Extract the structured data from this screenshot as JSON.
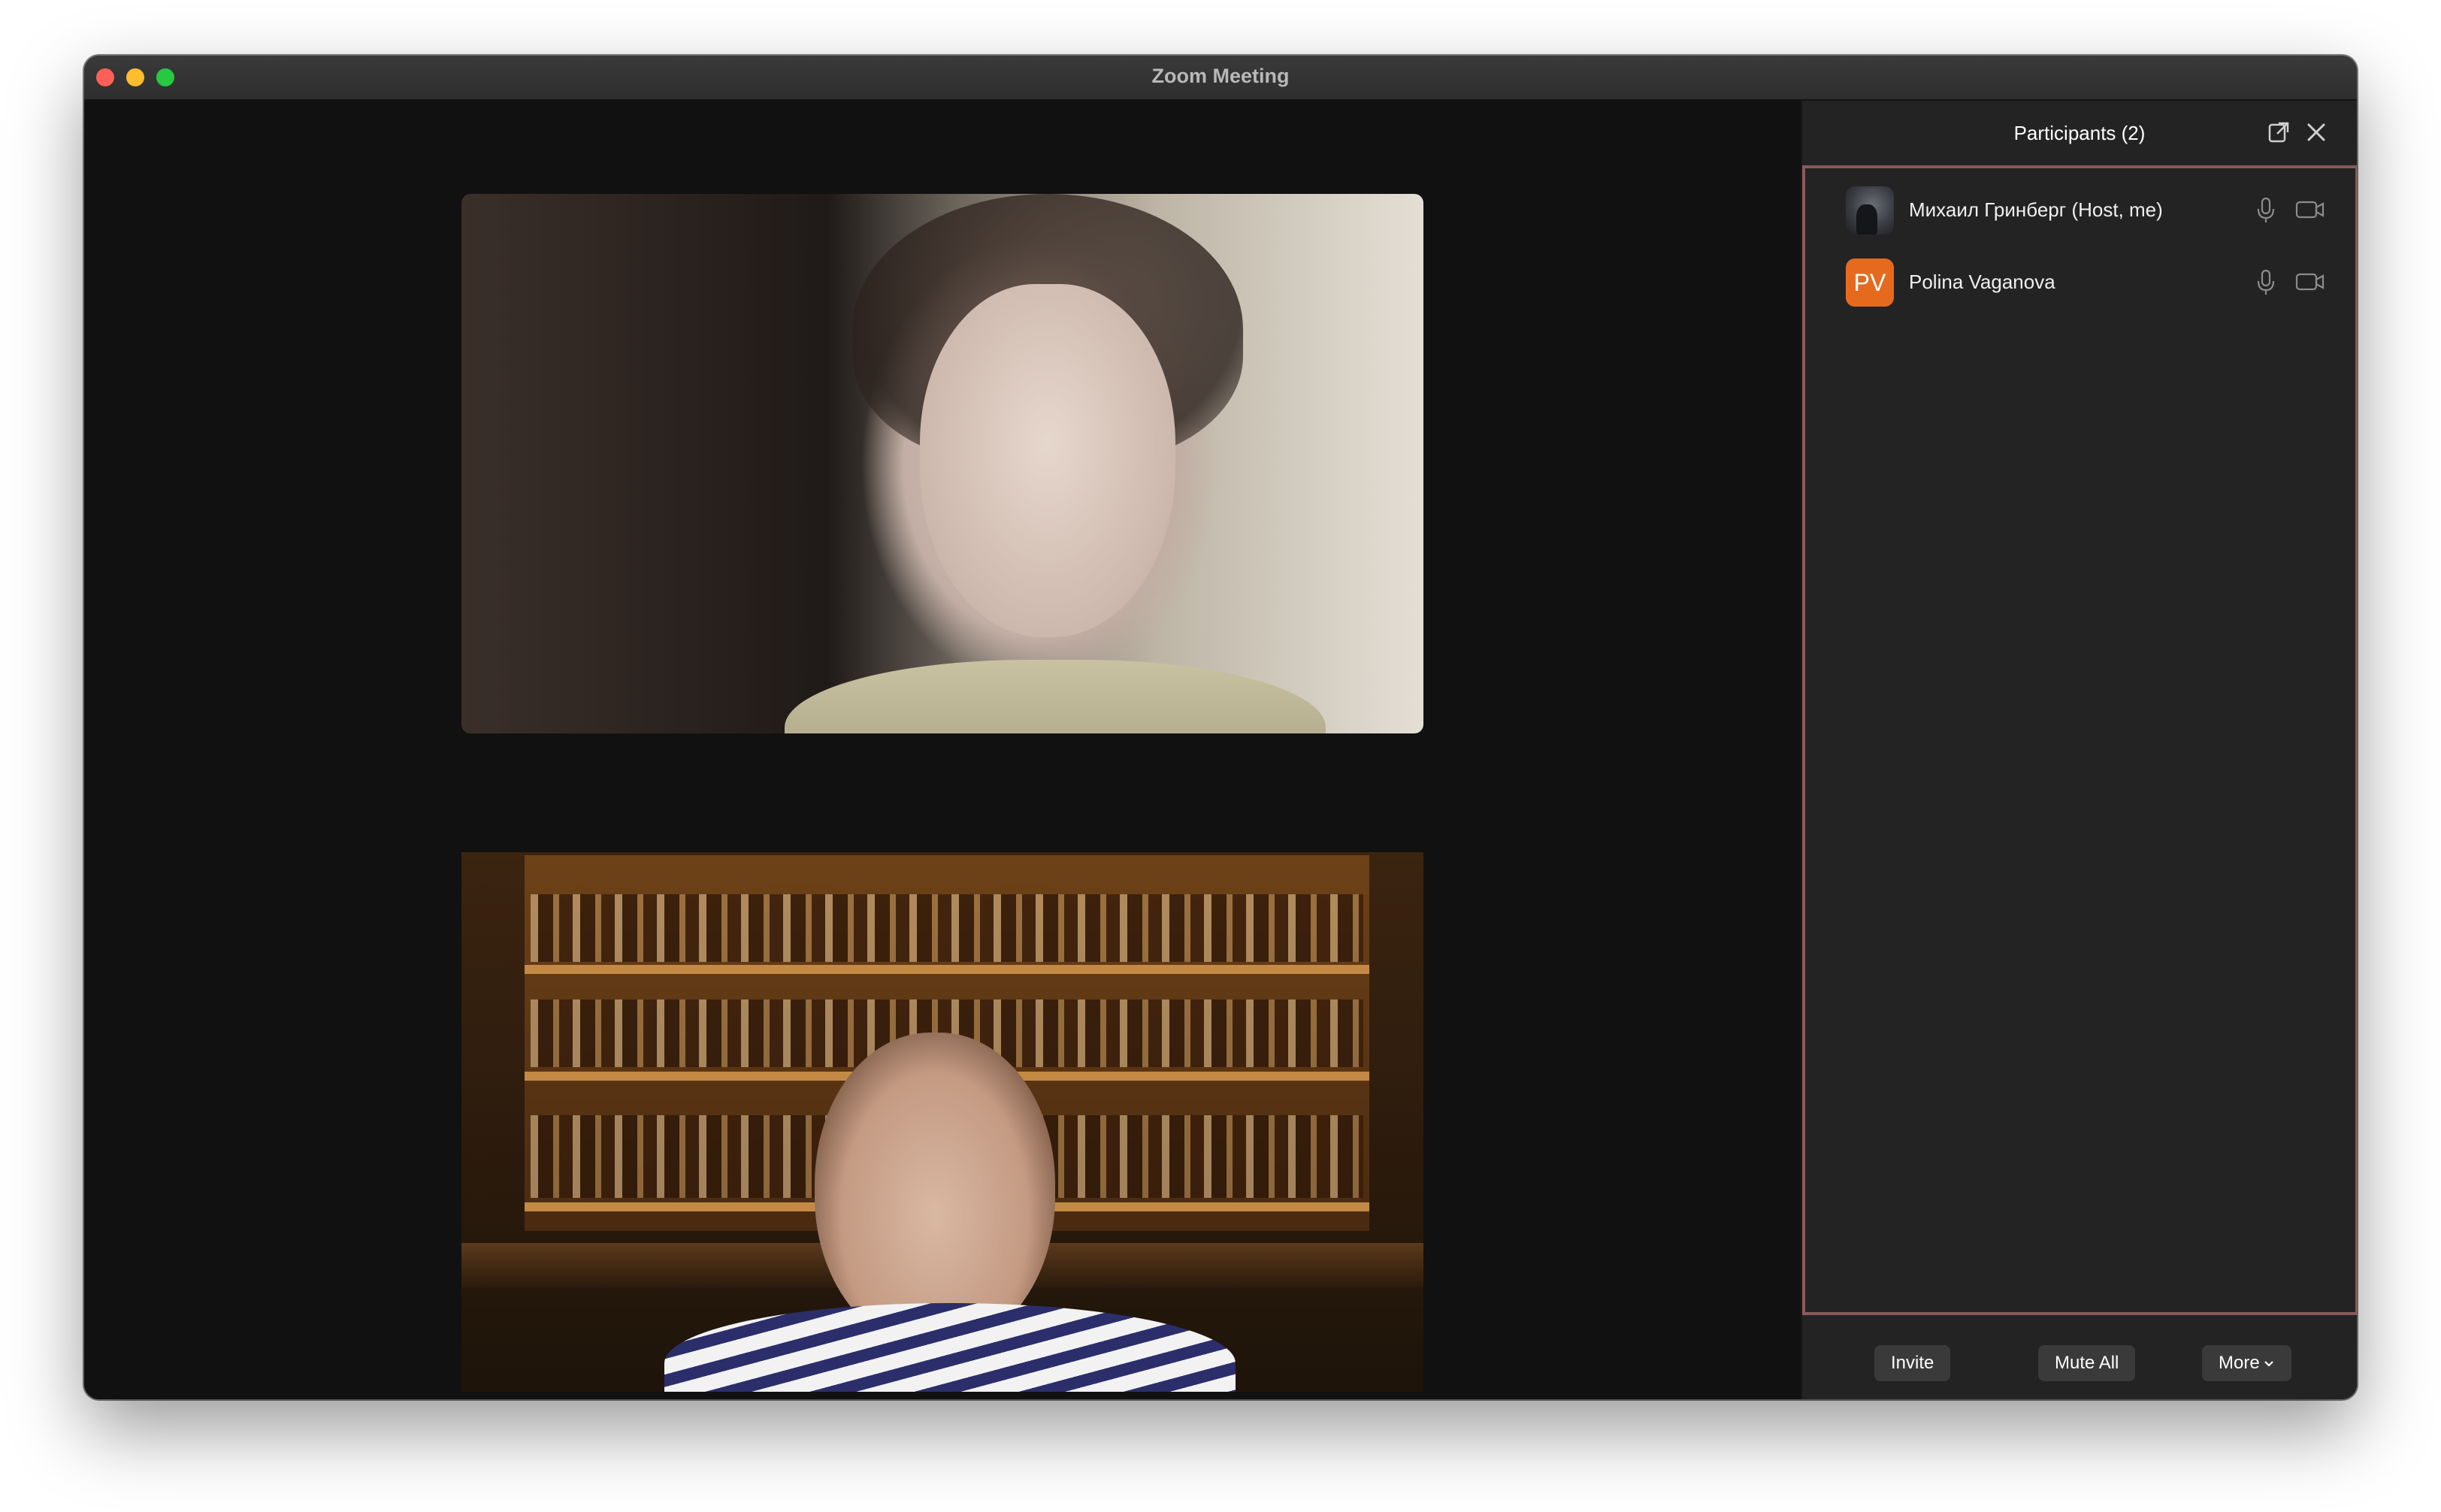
{
  "window": {
    "title": "Zoom Meeting"
  },
  "participants_panel": {
    "title": "Participants (2)",
    "participants": [
      {
        "name": "Михаил Гринберг (Host, me)",
        "avatar": "photo"
      },
      {
        "name": "Polina Vaganova",
        "initials": "PV",
        "avatar_color": "#e66a1e"
      }
    ],
    "buttons": {
      "invite": "Invite",
      "mute_all": "Mute All",
      "more": "More"
    }
  },
  "colors": {
    "panel_bg": "#232323",
    "stage_bg": "#111111",
    "list_border": "#8a5a5a",
    "avatar_orange": "#e66a1e"
  }
}
